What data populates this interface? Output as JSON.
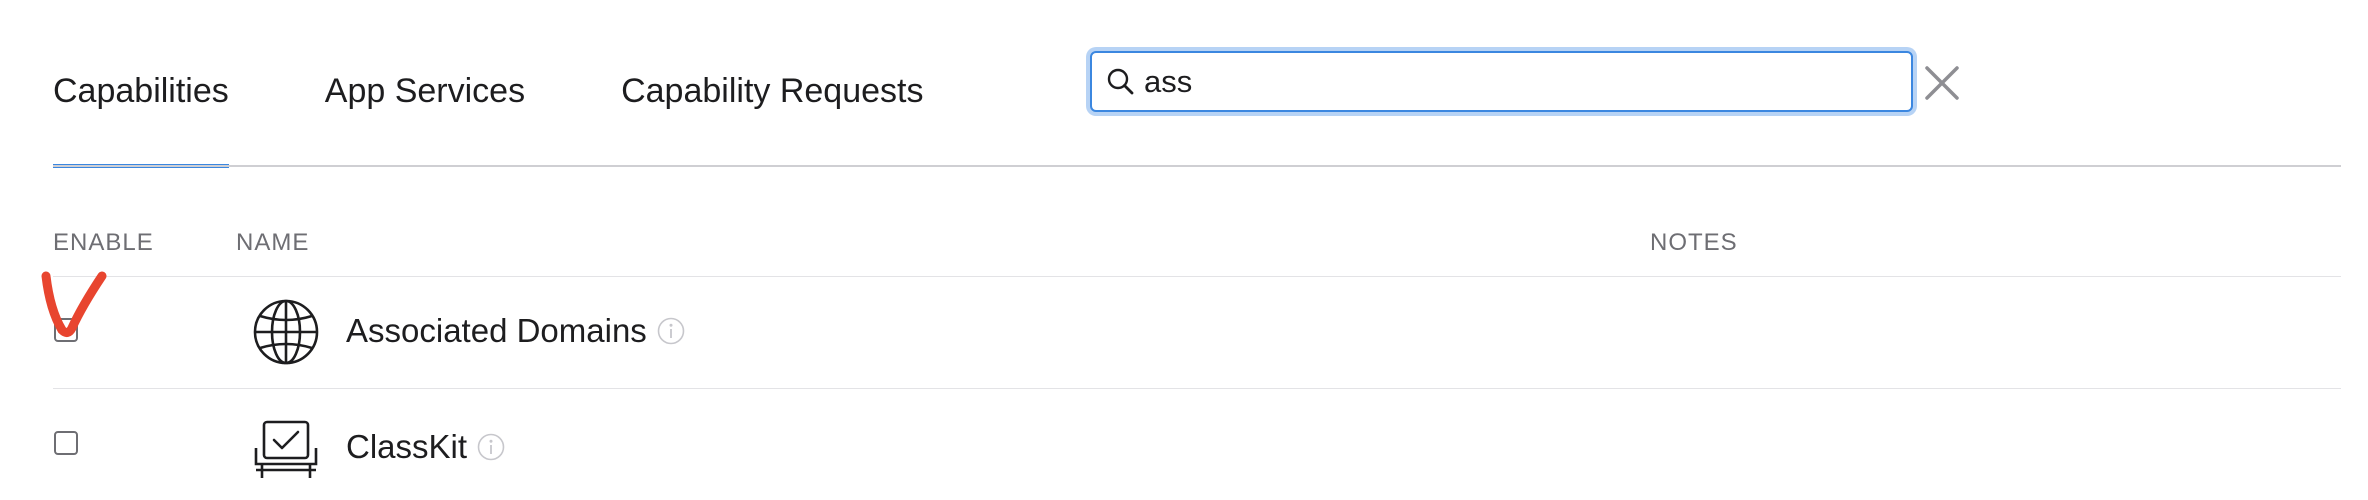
{
  "tabs": [
    {
      "label": "Capabilities",
      "active": true
    },
    {
      "label": "App Services",
      "active": false
    },
    {
      "label": "Capability Requests",
      "active": false
    }
  ],
  "search": {
    "value": "ass",
    "placeholder": ""
  },
  "table": {
    "columns": {
      "enable": "ENABLE",
      "name": "NAME",
      "notes": "NOTES"
    },
    "rows": [
      {
        "name": "Associated Domains",
        "icon": "globe-icon",
        "enabled": false,
        "notes": ""
      },
      {
        "name": "ClassKit",
        "icon": "classkit-icon",
        "enabled": false,
        "notes": ""
      }
    ]
  },
  "colors": {
    "accent": "#3b87e0",
    "annotation": "#e8452f",
    "muted_text": "#6e6e73"
  }
}
